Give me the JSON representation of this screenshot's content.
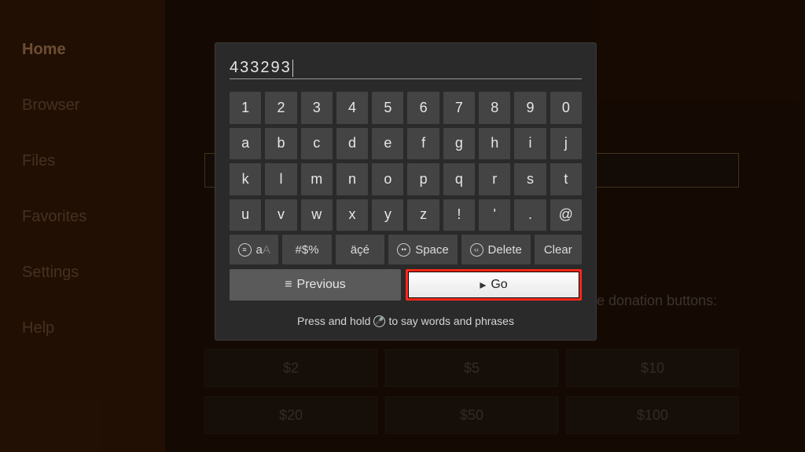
{
  "sidebar": {
    "items": [
      {
        "label": "Home",
        "active": true
      },
      {
        "label": "Browser",
        "active": false
      },
      {
        "label": "Files",
        "active": false
      },
      {
        "label": "Favorites",
        "active": false
      },
      {
        "label": "Settings",
        "active": false
      },
      {
        "label": "Help",
        "active": false
      }
    ]
  },
  "background": {
    "donation_hint": "se donation buttons:",
    "amounts_row1": [
      "$2",
      "$5",
      "$10"
    ],
    "amounts_row2": [
      "$20",
      "$50",
      "$100"
    ]
  },
  "input": {
    "value": "433293"
  },
  "keys": {
    "row1": [
      "1",
      "2",
      "3",
      "4",
      "5",
      "6",
      "7",
      "8",
      "9",
      "0"
    ],
    "row2": [
      "a",
      "b",
      "c",
      "d",
      "e",
      "f",
      "g",
      "h",
      "i",
      "j"
    ],
    "row3": [
      "k",
      "l",
      "m",
      "n",
      "o",
      "p",
      "q",
      "r",
      "s",
      "t"
    ],
    "row4": [
      "u",
      "v",
      "w",
      "x",
      "y",
      "z",
      "!",
      "'",
      ".",
      "@"
    ]
  },
  "fn": {
    "case": "aA",
    "symbols": "#$%",
    "accented": "äçé",
    "space": "Space",
    "delete": "Delete",
    "clear": "Clear"
  },
  "actions": {
    "previous": "Previous",
    "go": "Go"
  },
  "hint": {
    "prefix": "Press and hold",
    "suffix": "to say words and phrases"
  }
}
